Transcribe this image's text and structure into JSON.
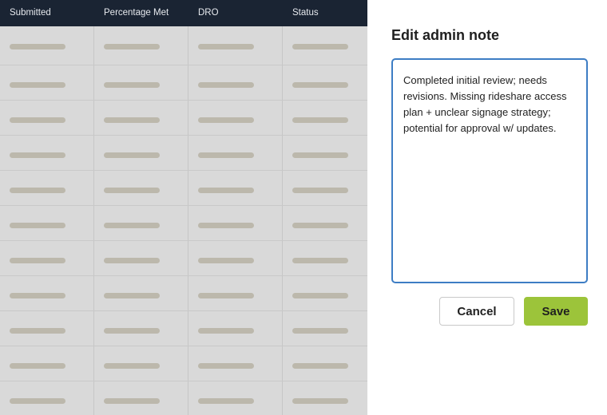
{
  "table": {
    "columns": [
      "Submitted",
      "Percentage Met",
      "DRO",
      "Status"
    ],
    "row_count": 11
  },
  "panel": {
    "title": "Edit admin note",
    "note_value": "Completed initial review; needs revisions. Missing rideshare access plan + unclear signage strategy; potential for approval w/ updates.",
    "cancel_label": "Cancel",
    "save_label": "Save"
  },
  "colors": {
    "header_bg": "#1a2433",
    "overlay_bg": "#d9d9d9",
    "placeholder_bar": "#bcb8ac",
    "focus_border": "#3d7dc4",
    "save_bg": "#9cc43a"
  }
}
